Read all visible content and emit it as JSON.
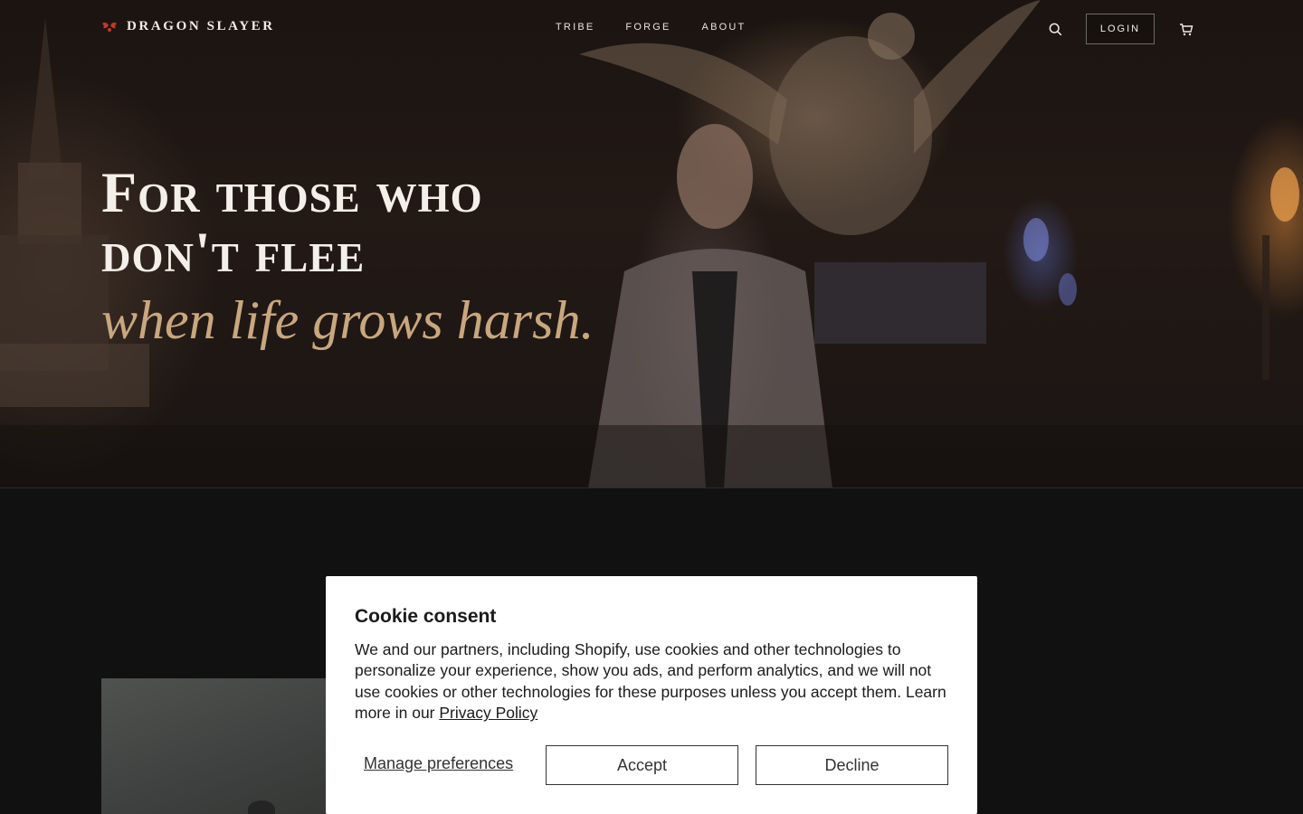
{
  "brand": {
    "name": "DRAGON SLAYER"
  },
  "nav": {
    "items": [
      "TRIBE",
      "FORGE",
      "ABOUT"
    ]
  },
  "header": {
    "login_label": "LOGIN"
  },
  "hero": {
    "headline_line1": "For those who",
    "headline_line2": "don't flee",
    "subline": "when life grows harsh."
  },
  "cookie": {
    "title": "Cookie consent",
    "body": "We and our partners, including Shopify, use cookies and other technologies to personalize your experience, show you ads, and perform analytics, and we will not use cookies or other technologies for these purposes unless you accept them. Learn more in our ",
    "privacy_link": "Privacy Policy",
    "manage_label": "Manage preferences",
    "accept_label": "Accept",
    "decline_label": "Decline"
  },
  "icons": {
    "logo": "dragon-logo-icon",
    "search": "search-icon",
    "cart": "cart-icon"
  },
  "colors": {
    "accent_gold": "#c9a77e",
    "logo_red": "#c0392b",
    "background": "#111111"
  }
}
